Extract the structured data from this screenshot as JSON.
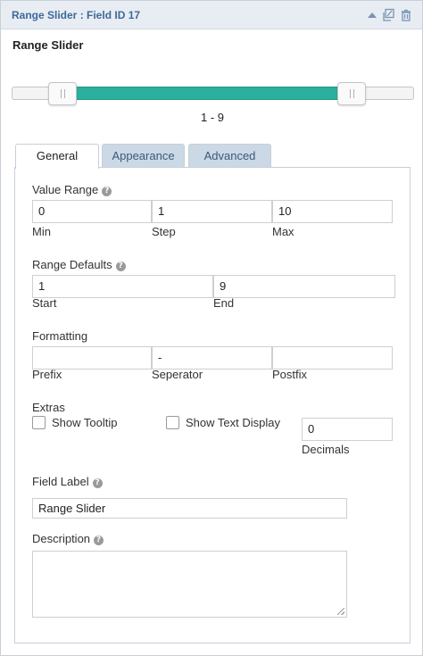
{
  "window": {
    "title": "Range Slider : Field ID 17",
    "icons": [
      "collapse-icon",
      "duplicate-icon",
      "delete-icon"
    ]
  },
  "field_heading": "Range Slider",
  "slider": {
    "min": 0,
    "max": 10,
    "start": 1,
    "end": 9,
    "readout": "1 - 9",
    "fill_color": "#2ab09c"
  },
  "tabs": [
    {
      "label": "General",
      "active": true
    },
    {
      "label": "Appearance",
      "active": false
    },
    {
      "label": "Advanced",
      "active": false
    }
  ],
  "general": {
    "value_range": {
      "label": "Value Range",
      "min": {
        "value": "0",
        "caption": "Min"
      },
      "step": {
        "value": "1",
        "caption": "Step"
      },
      "max": {
        "value": "10",
        "caption": "Max"
      }
    },
    "range_defaults": {
      "label": "Range Defaults",
      "start": {
        "value": "1",
        "caption": "Start"
      },
      "end": {
        "value": "9",
        "caption": "End"
      }
    },
    "formatting": {
      "label": "Formatting",
      "prefix": {
        "value": "",
        "caption": "Prefix"
      },
      "separator": {
        "value": "-",
        "caption": "Seperator"
      },
      "postfix": {
        "value": "",
        "caption": "Postfix"
      }
    },
    "extras": {
      "label": "Extras",
      "show_tooltip": {
        "label": "Show Tooltip",
        "checked": false
      },
      "show_text_display": {
        "label": "Show Text Display",
        "checked": false
      },
      "decimals": {
        "value": "0",
        "caption": "Decimals"
      }
    },
    "field_label": {
      "label": "Field Label",
      "value": "Range Slider"
    },
    "description": {
      "label": "Description",
      "value": ""
    }
  },
  "colors": {
    "title_text": "#3d6a98",
    "titlebar_bg": "#e8ecf3",
    "tab_inactive_bg": "#cbd8e6",
    "slider_fill": "#2ab09c"
  }
}
